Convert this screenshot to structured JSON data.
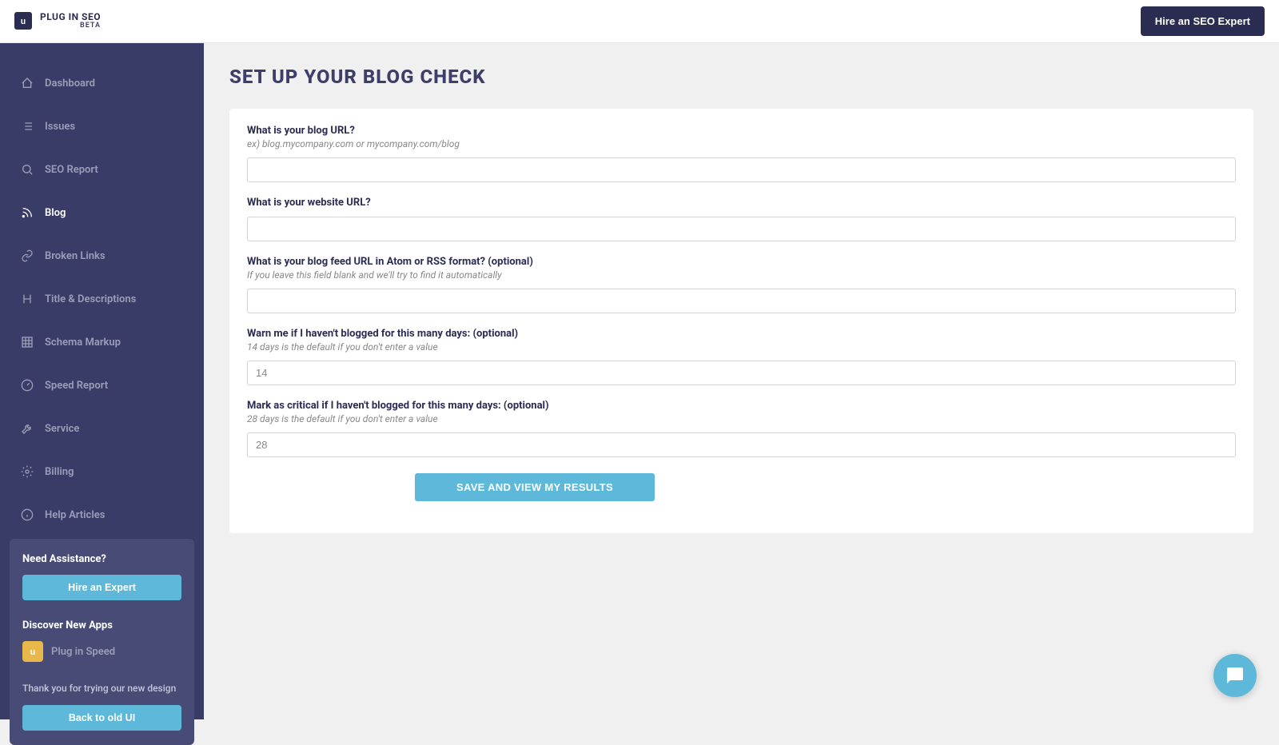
{
  "header": {
    "logo_text": "PLUG IN SEO",
    "logo_sub": "BETA",
    "hire_label": "Hire an SEO Expert"
  },
  "sidebar": {
    "items": [
      {
        "label": "Dashboard",
        "icon": "home"
      },
      {
        "label": "Issues",
        "icon": "list"
      },
      {
        "label": "SEO Report",
        "icon": "search"
      },
      {
        "label": "Blog",
        "icon": "rss",
        "active": true
      },
      {
        "label": "Broken Links",
        "icon": "link"
      },
      {
        "label": "Title & Descriptions",
        "icon": "heading"
      },
      {
        "label": "Schema Markup",
        "icon": "grid"
      },
      {
        "label": "Speed Report",
        "icon": "gauge"
      },
      {
        "label": "Service",
        "icon": "wrench"
      },
      {
        "label": "Billing",
        "icon": "gear"
      },
      {
        "label": "Help Articles",
        "icon": "info"
      }
    ],
    "panel": {
      "assist_title": "Need Assistance?",
      "assist_btn": "Hire an Expert",
      "discover_title": "Discover New Apps",
      "app_name": "Plug in Speed",
      "note": "Thank you for trying our new design",
      "back_btn": "Back to old UI"
    }
  },
  "page": {
    "title": "SET UP YOUR BLOG CHECK",
    "fields": {
      "blog_url": {
        "label": "What is your blog URL?",
        "hint": "ex) blog.mycompany.com or mycompany.com/blog",
        "value": ""
      },
      "website_url": {
        "label": "What is your website URL?",
        "value": ""
      },
      "feed_url": {
        "label": "What is your blog feed URL in Atom or RSS format? (optional)",
        "hint": "If you leave this field blank and we'll try to find it automatically",
        "value": ""
      },
      "warn_days": {
        "label": "Warn me if I haven't blogged for this many days: (optional)",
        "hint": "14 days is the default if you don't enter a value",
        "value": "14"
      },
      "critical_days": {
        "label": "Mark as critical if I haven't blogged for this many days: (optional)",
        "hint": "28 days is the default if you don't enter a value",
        "value": "28"
      }
    },
    "save_label": "SAVE AND VIEW MY RESULTS"
  }
}
